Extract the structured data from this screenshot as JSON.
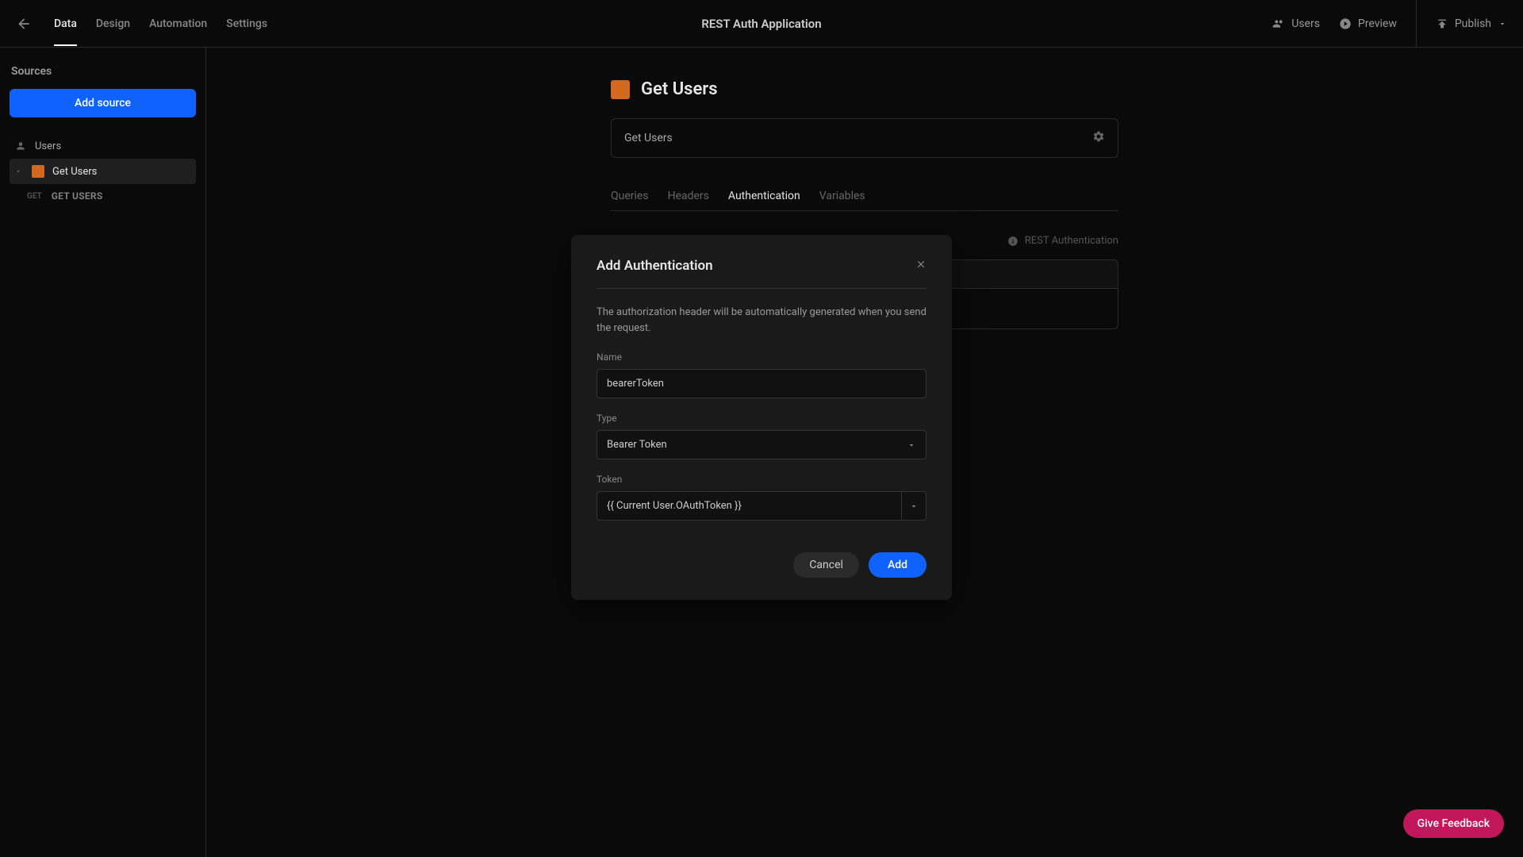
{
  "topbar": {
    "nav": [
      "Data",
      "Design",
      "Automation",
      "Settings"
    ],
    "activeNav": 0,
    "title": "REST Auth Application",
    "actions": {
      "users": "Users",
      "preview": "Preview",
      "publish": "Publish"
    }
  },
  "sidebar": {
    "title": "Sources",
    "addBtn": "Add source",
    "items": [
      {
        "label": "Users",
        "type": "users"
      },
      {
        "label": "Get Users",
        "type": "rest",
        "selected": true
      }
    ],
    "subitem": {
      "method": "GET",
      "label": "GET USERS"
    }
  },
  "main": {
    "title": "Get Users",
    "nameValue": "Get Users",
    "tabs": [
      "Queries",
      "Headers",
      "Authentication",
      "Variables"
    ],
    "activeTab": 2,
    "authInfoLabel": "REST Authentication"
  },
  "modal": {
    "title": "Add Authentication",
    "description": "The authorization header will be automatically generated when you send the request.",
    "nameLabel": "Name",
    "nameValue": "bearerToken",
    "typeLabel": "Type",
    "typeValue": "Bearer Token",
    "tokenLabel": "Token",
    "tokenValue": "{{ Current User.OAuthToken }}",
    "cancel": "Cancel",
    "add": "Add"
  },
  "feedback": "Give Feedback"
}
